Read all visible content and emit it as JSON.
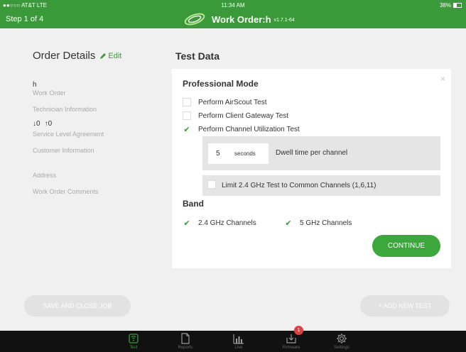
{
  "status_bar": {
    "carrier": "●●○○○ AT&T  LTE",
    "time": "11:34 AM",
    "battery": "38%"
  },
  "header": {
    "step": "Step 1 of 4",
    "title": "Work Order:h",
    "version": "v1.7.1-64"
  },
  "order_details": {
    "title": "Order Details",
    "edit_label": "Edit",
    "work_order_value": "h",
    "work_order_label": "Work Order",
    "technician_label": "Technician Information",
    "sla_down": "0",
    "sla_up": "0",
    "sla_label": "Service Level Agreement",
    "customer_label": "Customer Information",
    "address_label": "Address",
    "comments_label": "Work Order Comments"
  },
  "test_data": {
    "title": "Test Data",
    "close_symbol": "×",
    "mode_title": "Professional Mode",
    "options": [
      {
        "label": "Perform AirScout Test",
        "checked": false
      },
      {
        "label": "Perform Client Gateway Test",
        "checked": false
      },
      {
        "label": "Perform Channel Utilization Test",
        "checked": true
      }
    ],
    "dwell_value": "5",
    "dwell_unit": "seconds",
    "dwell_label": "Dwell time per channel",
    "limit_label": "Limit 2.4 GHz Test to Common Channels (1,6,11)",
    "limit_checked": false,
    "band_title": "Band",
    "band_options": [
      {
        "label": "2.4 GHz Channels",
        "checked": true
      },
      {
        "label": "5 GHz Channels",
        "checked": true
      }
    ],
    "continue_label": "CONTINUE"
  },
  "actions": {
    "save_label": "SAVE AND CLOSE JOB",
    "add_label": "+ ADD NEW TEST"
  },
  "tabs": [
    {
      "label": "Test",
      "icon": "test-icon",
      "active": true
    },
    {
      "label": "Reports",
      "icon": "reports-icon"
    },
    {
      "label": "Live",
      "icon": "live-icon"
    },
    {
      "label": "Firmware",
      "icon": "firmware-icon",
      "badge": "1"
    },
    {
      "label": "Settings",
      "icon": "settings-icon"
    }
  ],
  "colors": {
    "brand_green": "#3a9a3a",
    "tabbar_bg": "#111111",
    "badge_red": "#e04040"
  }
}
